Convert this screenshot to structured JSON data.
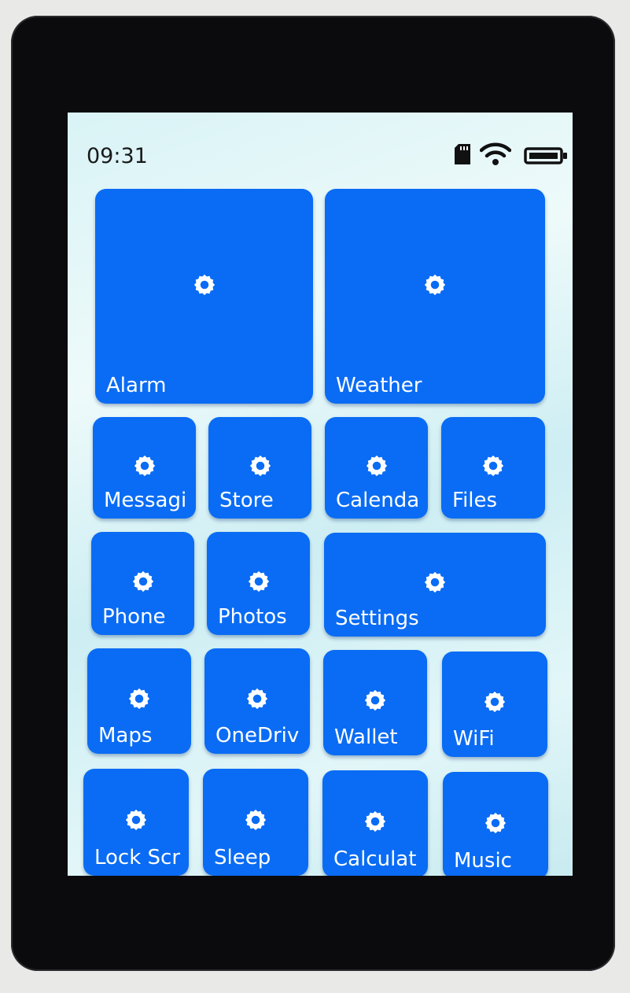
{
  "status_bar": {
    "time": "09:31",
    "icons": [
      "sd-card-icon",
      "wifi-icon",
      "battery-icon"
    ]
  },
  "colors": {
    "tile": "#0a6cf4",
    "tile_text": "#ffffff",
    "background": "#e3f6f8"
  },
  "tiles": [
    {
      "label": "Alarm",
      "icon": "gear-icon"
    },
    {
      "label": "Weather",
      "icon": "gear-icon"
    },
    {
      "label": "Messagi",
      "icon": "gear-icon"
    },
    {
      "label": "Store",
      "icon": "gear-icon"
    },
    {
      "label": "Calenda",
      "icon": "gear-icon"
    },
    {
      "label": "Files",
      "icon": "gear-icon"
    },
    {
      "label": "Phone",
      "icon": "gear-icon"
    },
    {
      "label": "Photos",
      "icon": "gear-icon"
    },
    {
      "label": "Settings",
      "icon": "gear-icon"
    },
    {
      "label": "Maps",
      "icon": "gear-icon"
    },
    {
      "label": "OneDriv",
      "icon": "gear-icon"
    },
    {
      "label": "Wallet",
      "icon": "gear-icon"
    },
    {
      "label": "WiFi",
      "icon": "gear-icon"
    },
    {
      "label": "Lock Scr",
      "icon": "gear-icon"
    },
    {
      "label": "Sleep",
      "icon": "gear-icon"
    },
    {
      "label": "Calculat",
      "icon": "gear-icon"
    },
    {
      "label": "Music",
      "icon": "gear-icon"
    }
  ]
}
